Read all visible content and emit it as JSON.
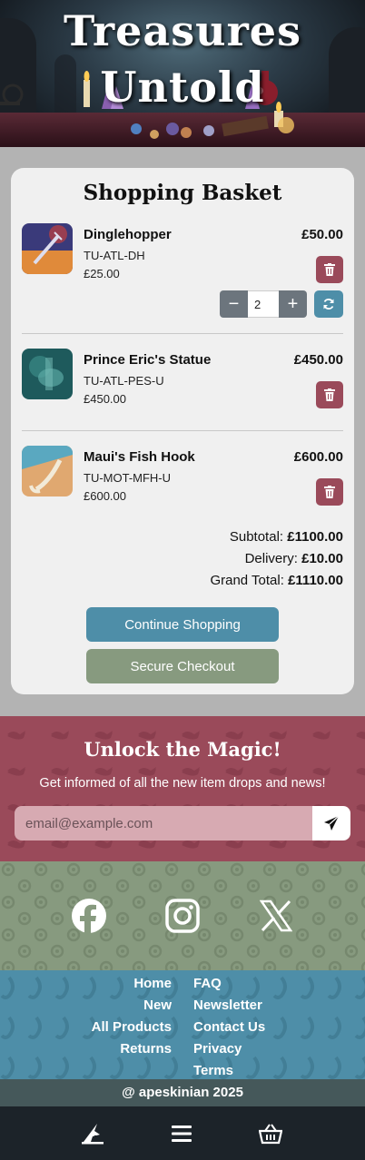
{
  "brand": {
    "title_line1": "Treasures",
    "title_line2": "Untold"
  },
  "basket": {
    "title": "Shopping Basket",
    "items": [
      {
        "name": "Dinglehopper",
        "sku": "TU-ATL-DH",
        "unit_price": "£25.00",
        "line_total": "£50.00",
        "quantity": "2",
        "thumb_icon": "fork-image"
      },
      {
        "name": "Prince Eric's Statue",
        "sku": "TU-ATL-PES-U",
        "unit_price": "£450.00",
        "line_total": "£450.00",
        "thumb_icon": "statue-image"
      },
      {
        "name": "Maui's Fish Hook",
        "sku": "TU-MOT-MFH-U",
        "unit_price": "£600.00",
        "line_total": "£600.00",
        "thumb_icon": "hook-image"
      }
    ],
    "subtotal_label": "Subtotal:",
    "subtotal": "£1100.00",
    "delivery_label": "Delivery:",
    "delivery": "£10.00",
    "grand_total_label": "Grand Total:",
    "grand_total": "£1110.00",
    "continue_label": "Continue Shopping",
    "checkout_label": "Secure Checkout"
  },
  "newsletter": {
    "title": "Unlock the Magic!",
    "subtitle": "Get informed of all the new item drops and news!",
    "email_placeholder": "email@example.com"
  },
  "social": {
    "icons": [
      "facebook-icon",
      "instagram-icon",
      "x-icon"
    ]
  },
  "footer_links": {
    "left": [
      "Home",
      "New",
      "All Products",
      "Returns"
    ],
    "right": [
      "FAQ",
      "Newsletter",
      "Contact Us",
      "Privacy",
      "Terms"
    ]
  },
  "copyright": "@ apeskinian 2025",
  "bottom_nav": {
    "icons": [
      "wizard-hat-icon",
      "menu-icon",
      "basket-icon"
    ]
  },
  "colors": {
    "burgundy": "#9a4a5a",
    "sage": "#879a7f",
    "teal": "#4e8ea8",
    "slate": "#45585a",
    "nav": "#1c2329"
  }
}
